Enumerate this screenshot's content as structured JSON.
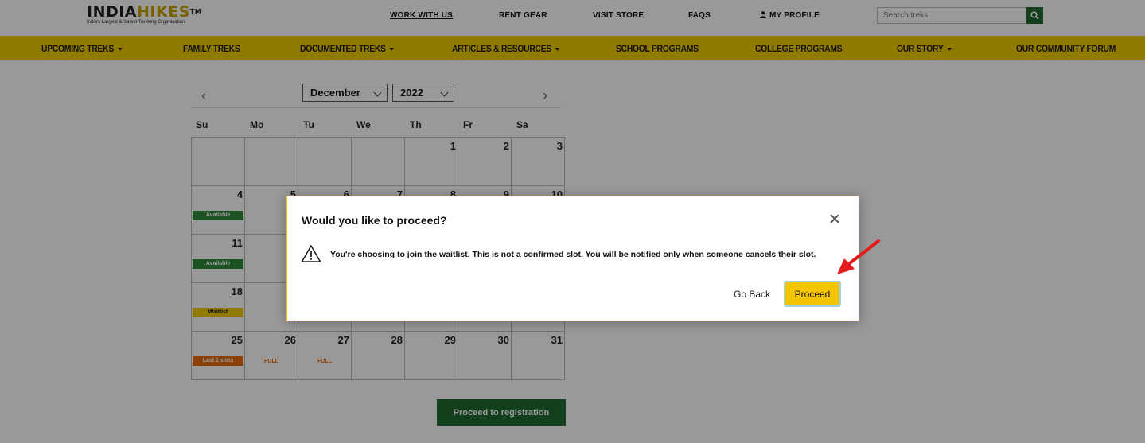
{
  "header": {
    "logo": {
      "main_a": "INDIA",
      "main_b": "HIKES",
      "tm": "TM",
      "tagline": "India's Largest & Safest Trekking Organisation"
    },
    "links": {
      "work_with_us": "WORK WITH US",
      "rent_gear": "RENT GEAR",
      "visit_store": "VISIT STORE",
      "faqs": "FAQS",
      "my_profile": "MY PROFILE"
    },
    "search": {
      "placeholder": "Search treks"
    }
  },
  "nav": {
    "items": [
      "UPCOMING TREKS",
      "FAMILY TREKS",
      "DOCUMENTED TREKS",
      "ARTICLES & RESOURCES",
      "SCHOOL PROGRAMS",
      "COLLEGE PROGRAMS",
      "OUR STORY",
      "OUR COMMUNITY FORUM"
    ]
  },
  "calendar": {
    "month": "December",
    "year": "2022",
    "weekdays": [
      "Su",
      "Mo",
      "Tu",
      "We",
      "Th",
      "Fr",
      "Sa"
    ],
    "days": {
      "d1": "1",
      "d2": "2",
      "d3": "3",
      "d4": "4",
      "d5": "5",
      "d6": "6",
      "d7": "7",
      "d8": "8",
      "d9": "9",
      "d10": "10",
      "d11": "11",
      "d18": "18",
      "d25": "25",
      "d26": "26",
      "d27": "27",
      "d28": "28",
      "d29": "29",
      "d30": "30",
      "d31": "31"
    },
    "badges": {
      "available": "Available",
      "waitlist": "Waitlist",
      "last_slots": "Last 1 slots",
      "full": "FULL"
    },
    "proceed_registration": "Proceed to registration"
  },
  "modal": {
    "title": "Would you like to proceed?",
    "message": "You're choosing to join the waitlist. This is not a confirmed slot. You will be notified only when someone cancels their slot.",
    "go_back": "Go Back",
    "proceed": "Proceed"
  },
  "colors": {
    "brand_yellow": "#f1cb00",
    "brand_green": "#1e6b2f",
    "available": "#2e8b3a",
    "orange": "#e86d0e",
    "annotation_red": "#e41b1b"
  }
}
